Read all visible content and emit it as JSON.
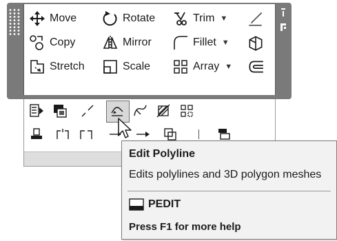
{
  "modify_panel": {
    "tools": [
      {
        "label": "Move",
        "icon": "move-icon"
      },
      {
        "label": "Rotate",
        "icon": "rotate-icon"
      },
      {
        "label": "Trim",
        "icon": "trim-icon"
      },
      {
        "label": "Copy",
        "icon": "copy-icon"
      },
      {
        "label": "Mirror",
        "icon": "mirror-icon"
      },
      {
        "label": "Fillet",
        "icon": "fillet-icon"
      },
      {
        "label": "Stretch",
        "icon": "stretch-icon"
      },
      {
        "label": "Scale",
        "icon": "scale-icon"
      },
      {
        "label": "Array",
        "icon": "array-icon"
      }
    ],
    "side_icons": [
      "erase-icon",
      "explode-icon",
      "offset-icon"
    ]
  },
  "lower_toolbar": {
    "row1_icons": [
      "match-properties-icon",
      "change-layer-icon",
      "break-icon",
      "edit-polyline-icon",
      "edit-spline-icon",
      "edit-hatch-icon",
      "edit-array-icon"
    ],
    "row2_icons": [
      "draworder-icon",
      "align-icon",
      "join-icon",
      "lengthen-icon",
      "move-arrow-icon",
      "copy-nested-icon",
      "divider",
      "drawing-order-icon"
    ],
    "hovered": "edit-polyline-icon"
  },
  "tooltip": {
    "title": "Edit Polyline",
    "description": "Edits polylines and 3D polygon meshes",
    "command": "PEDIT",
    "help": "Press F1 for more help",
    "command_icon": "command-line-icon"
  }
}
